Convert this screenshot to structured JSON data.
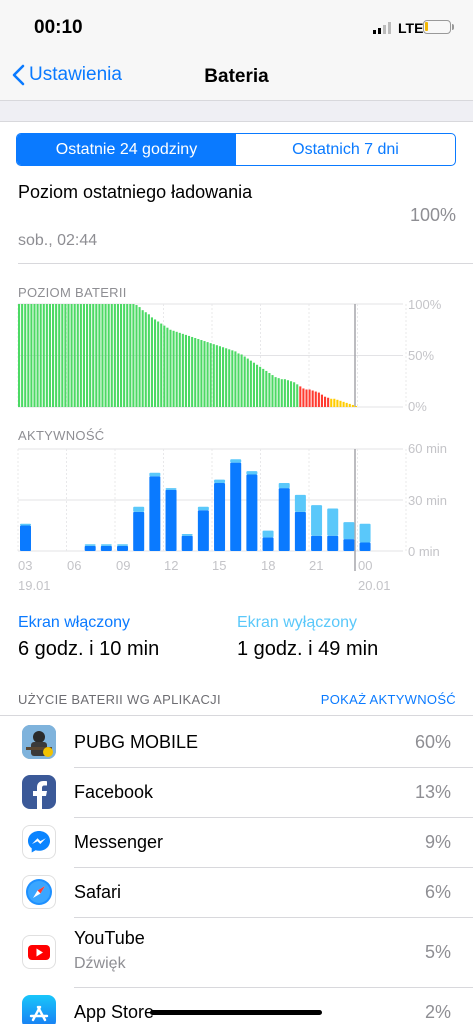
{
  "status_bar": {
    "time": "00:10",
    "network": "LTE"
  },
  "nav": {
    "back_label": "Ustawienia",
    "title": "Bateria"
  },
  "segments": {
    "left": "Ostatnie 24 godziny",
    "right": "Ostatnich 7 dni",
    "selected": "left"
  },
  "last_charge": {
    "label": "Poziom ostatniego ładowania",
    "time": "sob., 02:44",
    "value": "100%"
  },
  "battery_chart": {
    "label": "POZIOM BATERII",
    "y_labels": [
      "100%",
      "50%",
      "0%"
    ]
  },
  "activity_chart": {
    "label": "AKTYWNOŚĆ",
    "y_labels": [
      "60 min",
      "30 min",
      "0 min"
    ],
    "x_labels": [
      "03",
      "06",
      "09",
      "12",
      "15",
      "18",
      "21",
      "00"
    ],
    "date_left": "19.01",
    "date_right": "20.01"
  },
  "chart_data": [
    {
      "type": "bar",
      "title": "POZIOM BATERII",
      "ylim": [
        0,
        100
      ],
      "values": [
        100,
        100,
        100,
        100,
        100,
        100,
        100,
        100,
        100,
        100,
        100,
        100,
        100,
        100,
        100,
        100,
        100,
        100,
        100,
        100,
        100,
        100,
        100,
        100,
        100,
        100,
        100,
        100,
        100,
        100,
        100,
        100,
        100,
        100,
        100,
        100,
        100,
        100,
        99,
        97,
        94,
        92,
        90,
        87,
        85,
        83,
        81,
        79,
        77,
        75,
        74,
        73,
        72,
        71,
        70,
        69,
        68,
        67,
        66,
        65,
        64,
        63,
        62,
        61,
        60,
        59,
        58,
        57,
        56,
        55,
        54,
        52,
        51,
        49,
        47,
        45,
        43,
        41,
        39,
        37,
        35,
        33,
        31,
        29,
        28,
        27,
        27,
        26,
        25,
        24,
        22,
        20,
        18,
        17,
        17,
        16,
        15,
        14,
        12,
        10,
        9,
        8,
        8,
        7,
        6,
        5,
        4,
        3,
        2,
        1
      ],
      "colors": {
        "normal": "#4cd964",
        "low": "#ff3b30",
        "saver": "#ffcc00"
      }
    },
    {
      "type": "bar",
      "title": "AKTYWNOŚĆ",
      "ylim": [
        0,
        60
      ],
      "categories": [
        "02",
        "03",
        "04",
        "05",
        "06",
        "07",
        "08",
        "09",
        "10",
        "11",
        "12",
        "13",
        "14",
        "15",
        "16",
        "17",
        "18",
        "19",
        "20",
        "21",
        "22",
        "23"
      ],
      "series": [
        {
          "name": "Ekran włączony",
          "values": [
            15,
            0,
            0,
            0,
            3,
            3,
            3,
            23,
            44,
            36,
            9,
            24,
            40,
            52,
            45,
            8,
            37,
            23,
            9,
            9,
            7,
            5
          ]
        },
        {
          "name": "Ekran wyłączony",
          "values": [
            1,
            0,
            0,
            0,
            1,
            1,
            1,
            3,
            2,
            1,
            1,
            2,
            2,
            2,
            2,
            4,
            3,
            10,
            18,
            16,
            10,
            11
          ]
        }
      ],
      "x_tick_labels": [
        "03",
        "06",
        "09",
        "12",
        "15",
        "18",
        "21",
        "00"
      ],
      "colors": {
        "screen_on": "#0a7aff",
        "screen_off": "#5ac8fa"
      }
    }
  ],
  "screen_on": {
    "label": "Ekran włączony",
    "value": "6 godz. i 10 min"
  },
  "screen_off": {
    "label": "Ekran wyłączony",
    "value": "1 godz. i 49 min"
  },
  "usage": {
    "header": "UŻYCIE BATERII WG APLIKACJI",
    "show_activity": "POKAŻ AKTYWNOŚĆ",
    "apps": [
      {
        "name": "PUBG MOBILE",
        "sub": "",
        "percent": "60%",
        "icon": "pubg-icon"
      },
      {
        "name": "Facebook",
        "sub": "",
        "percent": "13%",
        "icon": "facebook-icon"
      },
      {
        "name": "Messenger",
        "sub": "",
        "percent": "9%",
        "icon": "messenger-icon"
      },
      {
        "name": "Safari",
        "sub": "",
        "percent": "6%",
        "icon": "safari-icon"
      },
      {
        "name": "YouTube",
        "sub": "Dźwięk",
        "percent": "5%",
        "icon": "youtube-icon"
      },
      {
        "name": "App Store",
        "sub": "",
        "percent": "2%",
        "icon": "app-store-icon"
      }
    ]
  }
}
